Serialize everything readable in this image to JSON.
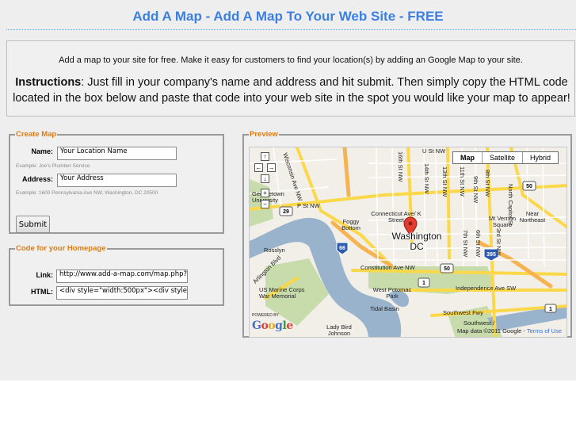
{
  "header": {
    "title": "Add A Map - Add A Map To Your Web Site - FREE"
  },
  "intro": {
    "text": "Add a map to your site for free. Make it easy for customers to find your location(s) by adding an Google Map to your site.",
    "instructions_label": "Instructions",
    "instructions_text": ": Just fill in your company's name and address and hit submit. Then simply copy the HTML code located in the box below and paste that code into your web site in the spot you would like your map to appear!"
  },
  "create_map": {
    "legend": "Create Map",
    "name_label": "Name:",
    "name_value": "Your Location Name",
    "name_example": "Example: Joe's Plumber Service",
    "address_label": "Address:",
    "address_value": "Your Address",
    "address_example": "Example: 1600 Pennsylvania Ave NW, Washington, DC 20500",
    "submit_label": "Submit"
  },
  "code_box": {
    "legend": "Code for your Homepage",
    "link_label": "Link:",
    "link_value": "http://www.add-a-map.com/map.php?nan",
    "html_label": "HTML:",
    "html_value": "<div style=\"width:500px\"><div style=\"widt"
  },
  "preview": {
    "legend": "Preview",
    "map_types": [
      "Map",
      "Satellite",
      "Hybrid"
    ],
    "active_map_type": "Map",
    "nav": {
      "up": "↑",
      "left": "←",
      "right": "→",
      "down": "↓",
      "zoom_in": "+",
      "zoom_out": "−"
    },
    "city_label_line1": "Washington",
    "city_label_line2": "DC",
    "labels": {
      "wisconsin": "Wisconsin Ave NW",
      "u_st": "U St NW",
      "st_16": "16th St NW",
      "st_14": "14th St NW",
      "st_13": "13th St NW",
      "st_11": "11th St NW",
      "st_9": "9th St NW",
      "st_8": "8th St NW",
      "st_7": "7th St NW",
      "st_6": "6th St NW",
      "st_3": "3rd St NW",
      "n_capitol": "North Capitol St",
      "georgetown": "Georgetown University",
      "p_st": "P St NW",
      "connecticut": "Connecticut Ave/ K Street",
      "foggy": "Foggy Bottom",
      "mt_vernon": "Mt Vernon Square",
      "near_ne": "Near Northeast",
      "rosslyn": "Rosslyn",
      "constitution": "Constitution Ave NW",
      "arlington": "Arlington Blvd",
      "marine": "US Marine Corps War Memorial",
      "west_potomac": "West Potomac Park",
      "tidal": "Tidal Basin",
      "independence": "Independence Ave SW",
      "southwest_fwy": "Southwest Fwy",
      "southwest": "Southwest /",
      "lady_bird": "Lady Bird Johnson",
      "shield_29": "29",
      "shield_66": "66",
      "shield_50a": "50",
      "shield_50b": "50",
      "shield_1": "1",
      "shield_395": "395",
      "shield_1b": "1"
    },
    "powered_by": "POWERED BY",
    "logo_letters": [
      "G",
      "o",
      "o",
      "g",
      "l",
      "e"
    ],
    "map_data_text": "Map data ©2011 Google - ",
    "terms_text": "Terms of Use"
  },
  "colors": {
    "title": "#3b7fe3",
    "legend": "#e07b10",
    "water": "#99b3cc",
    "park": "#c8dcab",
    "road_yellow": "#fbd84a",
    "road_orange": "#f6b353",
    "land": "#f2efe9"
  }
}
